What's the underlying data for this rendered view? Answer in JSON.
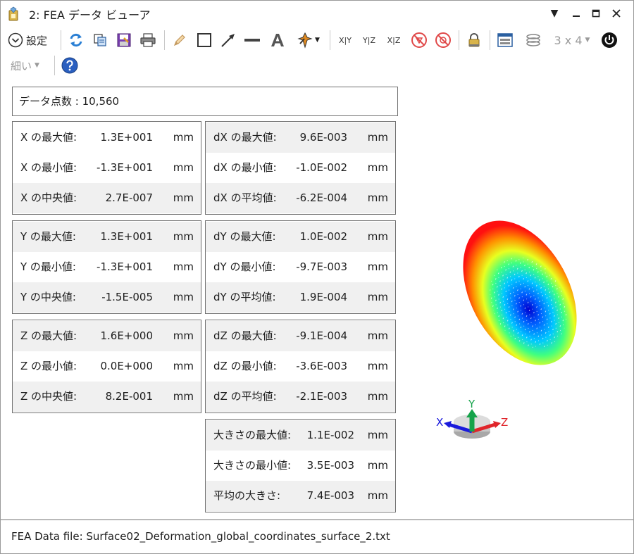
{
  "window": {
    "title": "2: FEA データ ビューア",
    "controls": [
      "dropdown",
      "minimize",
      "maximize",
      "close"
    ]
  },
  "toolbar": {
    "settings_label": "設定",
    "layout_label": "3 x 4",
    "line_width_label": "細い",
    "xy_label": "X|Y",
    "yz_label": "Y|Z",
    "xz_label": "X|Z",
    "icons": [
      "chevron-down-circle-icon",
      "refresh-icon",
      "copy-icon",
      "save-icon",
      "print-icon",
      "pencil-icon",
      "rectangle-icon",
      "arrow-icon",
      "line-icon",
      "text-icon",
      "pointer-icon",
      "xy-icon",
      "yz-icon",
      "xz-icon",
      "rotate-off-icon",
      "no-icon",
      "lock-icon",
      "window-icon",
      "layers-icon",
      "power-icon",
      "help-icon"
    ]
  },
  "data_count": {
    "label": "データ点数 : 10,560"
  },
  "panels": {
    "x": [
      {
        "label": "X の最大値:",
        "value": "1.3E+001",
        "unit": "mm"
      },
      {
        "label": "X の最小値:",
        "value": "-1.3E+001",
        "unit": "mm"
      },
      {
        "label": "X の中央値:",
        "value": "2.7E-007",
        "unit": "mm"
      }
    ],
    "dx": [
      {
        "label": "dX の最大値:",
        "value": "9.6E-003",
        "unit": "mm"
      },
      {
        "label": "dX の最小値:",
        "value": "-1.0E-002",
        "unit": "mm"
      },
      {
        "label": "dX の平均値:",
        "value": "-6.2E-004",
        "unit": "mm"
      }
    ],
    "y": [
      {
        "label": "Y の最大値:",
        "value": "1.3E+001",
        "unit": "mm"
      },
      {
        "label": "Y の最小値:",
        "value": "-1.3E+001",
        "unit": "mm"
      },
      {
        "label": "Y の中央値:",
        "value": "-1.5E-005",
        "unit": "mm"
      }
    ],
    "dy": [
      {
        "label": "dY の最大値:",
        "value": "1.0E-002",
        "unit": "mm"
      },
      {
        "label": "dY の最小値:",
        "value": "-9.7E-003",
        "unit": "mm"
      },
      {
        "label": "dY の平均値:",
        "value": "1.9E-004",
        "unit": "mm"
      }
    ],
    "z": [
      {
        "label": "Z の最大値:",
        "value": "1.6E+000",
        "unit": "mm"
      },
      {
        "label": "Z の最小値:",
        "value": "0.0E+000",
        "unit": "mm"
      },
      {
        "label": "Z の中央値:",
        "value": "8.2E-001",
        "unit": "mm"
      }
    ],
    "dz": [
      {
        "label": "dZ の最大値:",
        "value": "-9.1E-004",
        "unit": "mm"
      },
      {
        "label": "dZ の最小値:",
        "value": "-3.6E-003",
        "unit": "mm"
      },
      {
        "label": "dZ の平均値:",
        "value": "-2.1E-003",
        "unit": "mm"
      }
    ],
    "mag": [
      {
        "label": "大きさの最大値:",
        "value": "1.1E-002",
        "unit": "mm"
      },
      {
        "label": "大きさの最小値:",
        "value": "3.5E-003",
        "unit": "mm"
      },
      {
        "label": "平均の大きさ:",
        "value": "7.4E-003",
        "unit": "mm"
      }
    ]
  },
  "triad": {
    "x_label": "X",
    "y_label": "Y",
    "z_label": "Z",
    "colors": {
      "x": "#1a1adc",
      "y": "#15a34a",
      "z": "#e0252b"
    }
  },
  "status": {
    "file_label": "FEA Data file: Surface02_Deformation_global_coordinates_surface_2.txt"
  }
}
